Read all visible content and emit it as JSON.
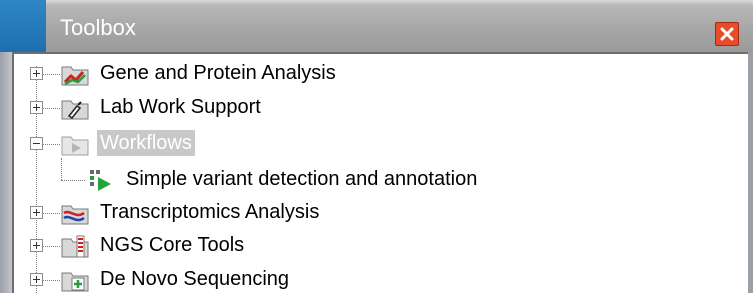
{
  "window": {
    "title": "Toolbox",
    "close_icon": "close-icon",
    "accent": "#e84c2b"
  },
  "tree": {
    "items": [
      {
        "label": "Gene and Protein Analysis",
        "icon": "gene-protein-folder-icon",
        "expander": "plus"
      },
      {
        "label": "Lab Work Support",
        "icon": "lab-work-folder-icon",
        "expander": "plus"
      },
      {
        "label": "Workflows",
        "icon": "workflows-folder-icon",
        "expander": "minus",
        "selected": true,
        "children": [
          {
            "label": "Simple variant detection and annotation",
            "icon": "workflow-run-icon"
          }
        ]
      },
      {
        "label": "Transcriptomics Analysis",
        "icon": "transcriptomics-folder-icon",
        "expander": "plus"
      },
      {
        "label": "NGS Core Tools",
        "icon": "ngs-core-tools-folder-icon",
        "expander": "plus"
      },
      {
        "label": "De Novo Sequencing",
        "icon": "de-novo-folder-icon",
        "expander": "plus"
      }
    ]
  }
}
